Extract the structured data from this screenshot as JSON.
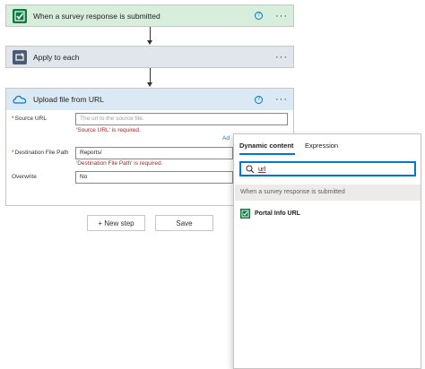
{
  "steps": {
    "survey": {
      "title": "When a survey response is submitted",
      "icon": "forms-check-icon"
    },
    "apply": {
      "title": "Apply to each",
      "icon": "loop-icon"
    },
    "upload": {
      "title": "Upload file from URL",
      "icon": "onedrive-cloud-icon"
    }
  },
  "help_glyph": "?",
  "more_glyph": "···",
  "form": {
    "source_url": {
      "label": "Source URL",
      "placeholder": "The url to the source file.",
      "error": "'Source URL' is required."
    },
    "add_link": "Ad",
    "destination": {
      "label": "Destination File Path",
      "value": "Reports/",
      "error": "'Destination File Path' is required."
    },
    "overwrite": {
      "label": "Overwrite",
      "value": "No"
    },
    "required_marker": "*"
  },
  "buttons": {
    "new_step": "+ New step",
    "save": "Save"
  },
  "panel": {
    "tabs": [
      "Dynamic content",
      "Expression"
    ],
    "active_tab": "Dynamic content",
    "search_value": "url",
    "group": "When a survey response is submitted",
    "items": [
      {
        "label": "Portal Info URL",
        "icon": "forms-check-icon"
      }
    ]
  },
  "colors": {
    "accent": "#0078d4",
    "forms_green": "#0d7a3e",
    "error_red": "#a4262c"
  }
}
